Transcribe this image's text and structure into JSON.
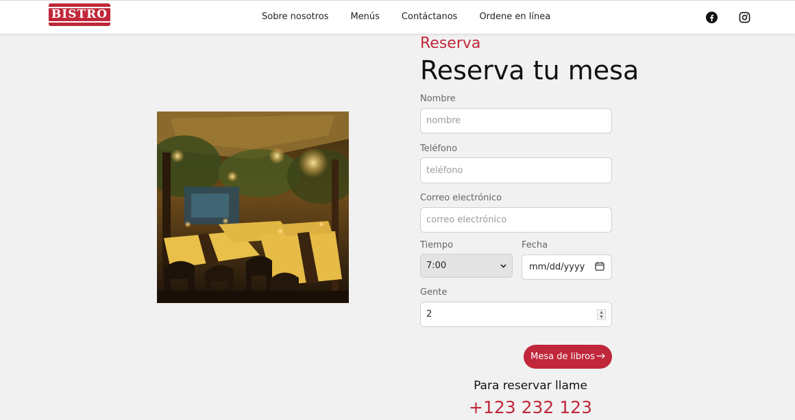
{
  "brand": {
    "logo_text": "BISTRO",
    "accent_color": "#c0273a"
  },
  "nav": {
    "items": [
      {
        "label": "Sobre nosotros"
      },
      {
        "label": "Menús"
      },
      {
        "label": "Contáctanos"
      },
      {
        "label": "Ordene en línea"
      }
    ],
    "social": [
      "facebook-icon",
      "instagram-icon"
    ]
  },
  "reservation": {
    "eyebrow": "Reserva",
    "title": "Reserva tu mesa",
    "fields": {
      "name": {
        "label": "Nombre",
        "placeholder": "nombre",
        "value": ""
      },
      "phone": {
        "label": "Teléfono",
        "placeholder": "teléfono",
        "value": ""
      },
      "email": {
        "label": "Correo electrónico",
        "placeholder": "correo electrónico",
        "value": ""
      },
      "time": {
        "label": "Tiempo",
        "value": "7:00"
      },
      "date": {
        "label": "Fecha",
        "value": "mm/dd/yyyy"
      },
      "people": {
        "label": "Gente",
        "value": "2"
      }
    },
    "submit_label": "Mesa de libros",
    "call_label": "Para reservar llame",
    "phone_number": "+123 232 123"
  }
}
